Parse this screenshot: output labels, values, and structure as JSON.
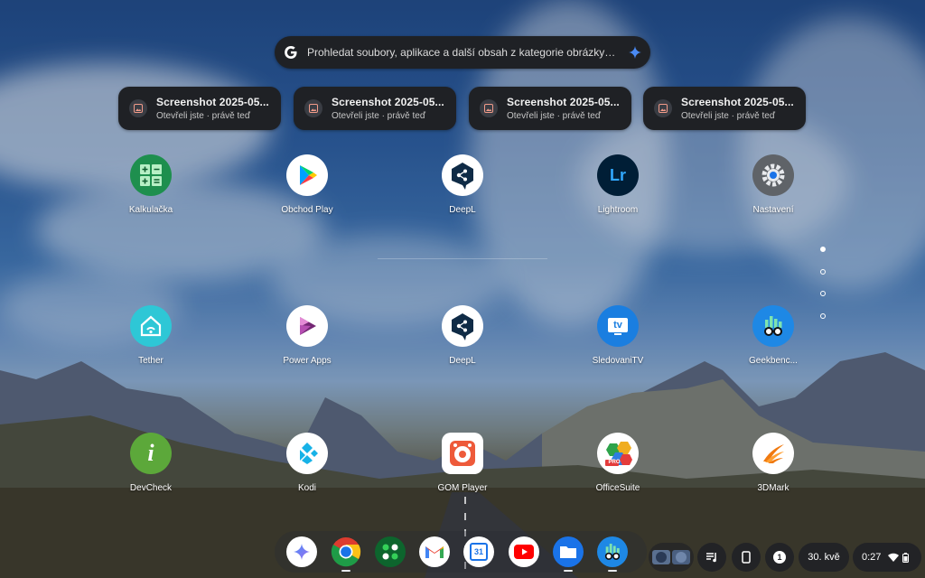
{
  "search": {
    "placeholder": "Prohledat soubory, aplikace a další obsah z kategorie obrázky…"
  },
  "recent": [
    {
      "title": "Screenshot 2025-05...",
      "subtitle": "Otevřeli jste · právě teď"
    },
    {
      "title": "Screenshot 2025-05...",
      "subtitle": "Otevřeli jste · právě teď"
    },
    {
      "title": "Screenshot 2025-05...",
      "subtitle": "Otevřeli jste · právě teď"
    },
    {
      "title": "Screenshot 2025-05...",
      "subtitle": "Otevřeli jste · právě teď"
    }
  ],
  "apps": [
    {
      "label": "Kalkulačka",
      "icon": "calculator-icon"
    },
    {
      "label": "Obchod Play",
      "icon": "play-store-icon"
    },
    {
      "label": "DeepL",
      "icon": "deepl-icon"
    },
    {
      "label": "Lightroom",
      "icon": "lightroom-icon"
    },
    {
      "label": "Nastavení",
      "icon": "settings-icon"
    },
    {
      "label": "Tether",
      "icon": "tether-icon"
    },
    {
      "label": "Power Apps",
      "icon": "power-apps-icon"
    },
    {
      "label": "DeepL",
      "icon": "deepl-icon"
    },
    {
      "label": "SledovaniTV",
      "icon": "sledovanitv-icon"
    },
    {
      "label": "Geekbenc...",
      "icon": "geekbench-icon"
    },
    {
      "label": "DevCheck",
      "icon": "devcheck-icon"
    },
    {
      "label": "Kodi",
      "icon": "kodi-icon"
    },
    {
      "label": "GOM Player",
      "icon": "gom-player-icon"
    },
    {
      "label": "OfficeSuite",
      "icon": "officesuite-icon"
    },
    {
      "label": "3DMark",
      "icon": "3dmark-icon"
    }
  ],
  "icon_text": {
    "lightroom": "Lr",
    "sledovanitv": "tv",
    "devcheck": "i",
    "calendar": "31",
    "notification_count": "1",
    "office_pro": "PRO"
  },
  "pager": {
    "pages": 4,
    "current": 1
  },
  "shelf": [
    {
      "name": "Gemini",
      "icon": "gemini-icon"
    },
    {
      "name": "Chrome",
      "icon": "chrome-icon"
    },
    {
      "name": "Google Play Games",
      "icon": "apps-grid-icon"
    },
    {
      "name": "Gmail",
      "icon": "gmail-icon"
    },
    {
      "name": "Kalendář",
      "icon": "calendar-icon"
    },
    {
      "name": "YouTube",
      "icon": "youtube-icon"
    },
    {
      "name": "Soubory",
      "icon": "files-icon"
    },
    {
      "name": "Geekbench",
      "icon": "geekbench-icon"
    }
  ],
  "tray": {
    "date": "30. kvě",
    "time": "0:27"
  },
  "colors": {
    "chip_bg": "#1f2125",
    "search_bg": "#1f2125",
    "accent_blue": "#4a8af4"
  }
}
